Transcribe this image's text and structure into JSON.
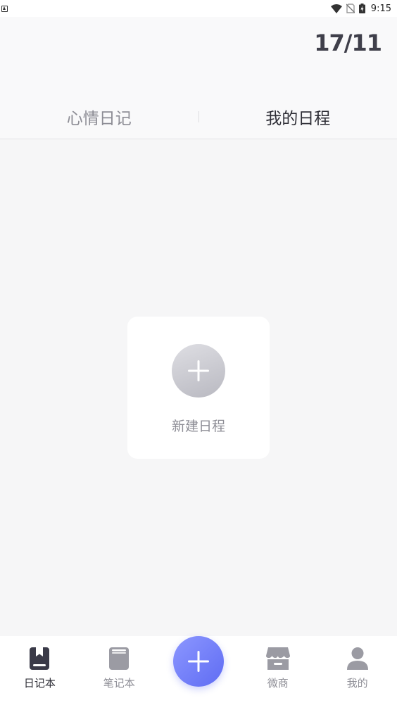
{
  "status_bar": {
    "time": "9:15"
  },
  "header": {
    "date": "17/11"
  },
  "tabs": [
    {
      "label": "心情日记",
      "active": false
    },
    {
      "label": "我的日程",
      "active": true
    }
  ],
  "empty_card": {
    "label": "新建日程"
  },
  "bottom_nav": [
    {
      "label": "日记本",
      "icon": "diary-book-icon",
      "active": true
    },
    {
      "label": "笔记本",
      "icon": "notebook-icon",
      "active": false
    },
    {
      "label": "",
      "icon": "plus-icon",
      "active": false
    },
    {
      "label": "微商",
      "icon": "shop-icon",
      "active": false
    },
    {
      "label": "我的",
      "icon": "user-icon",
      "active": false
    }
  ],
  "colors": {
    "accent": "#6b78f7",
    "active_text": "#2f2f37",
    "inactive_text": "#8d8d95",
    "background": "#f6f6f7"
  }
}
